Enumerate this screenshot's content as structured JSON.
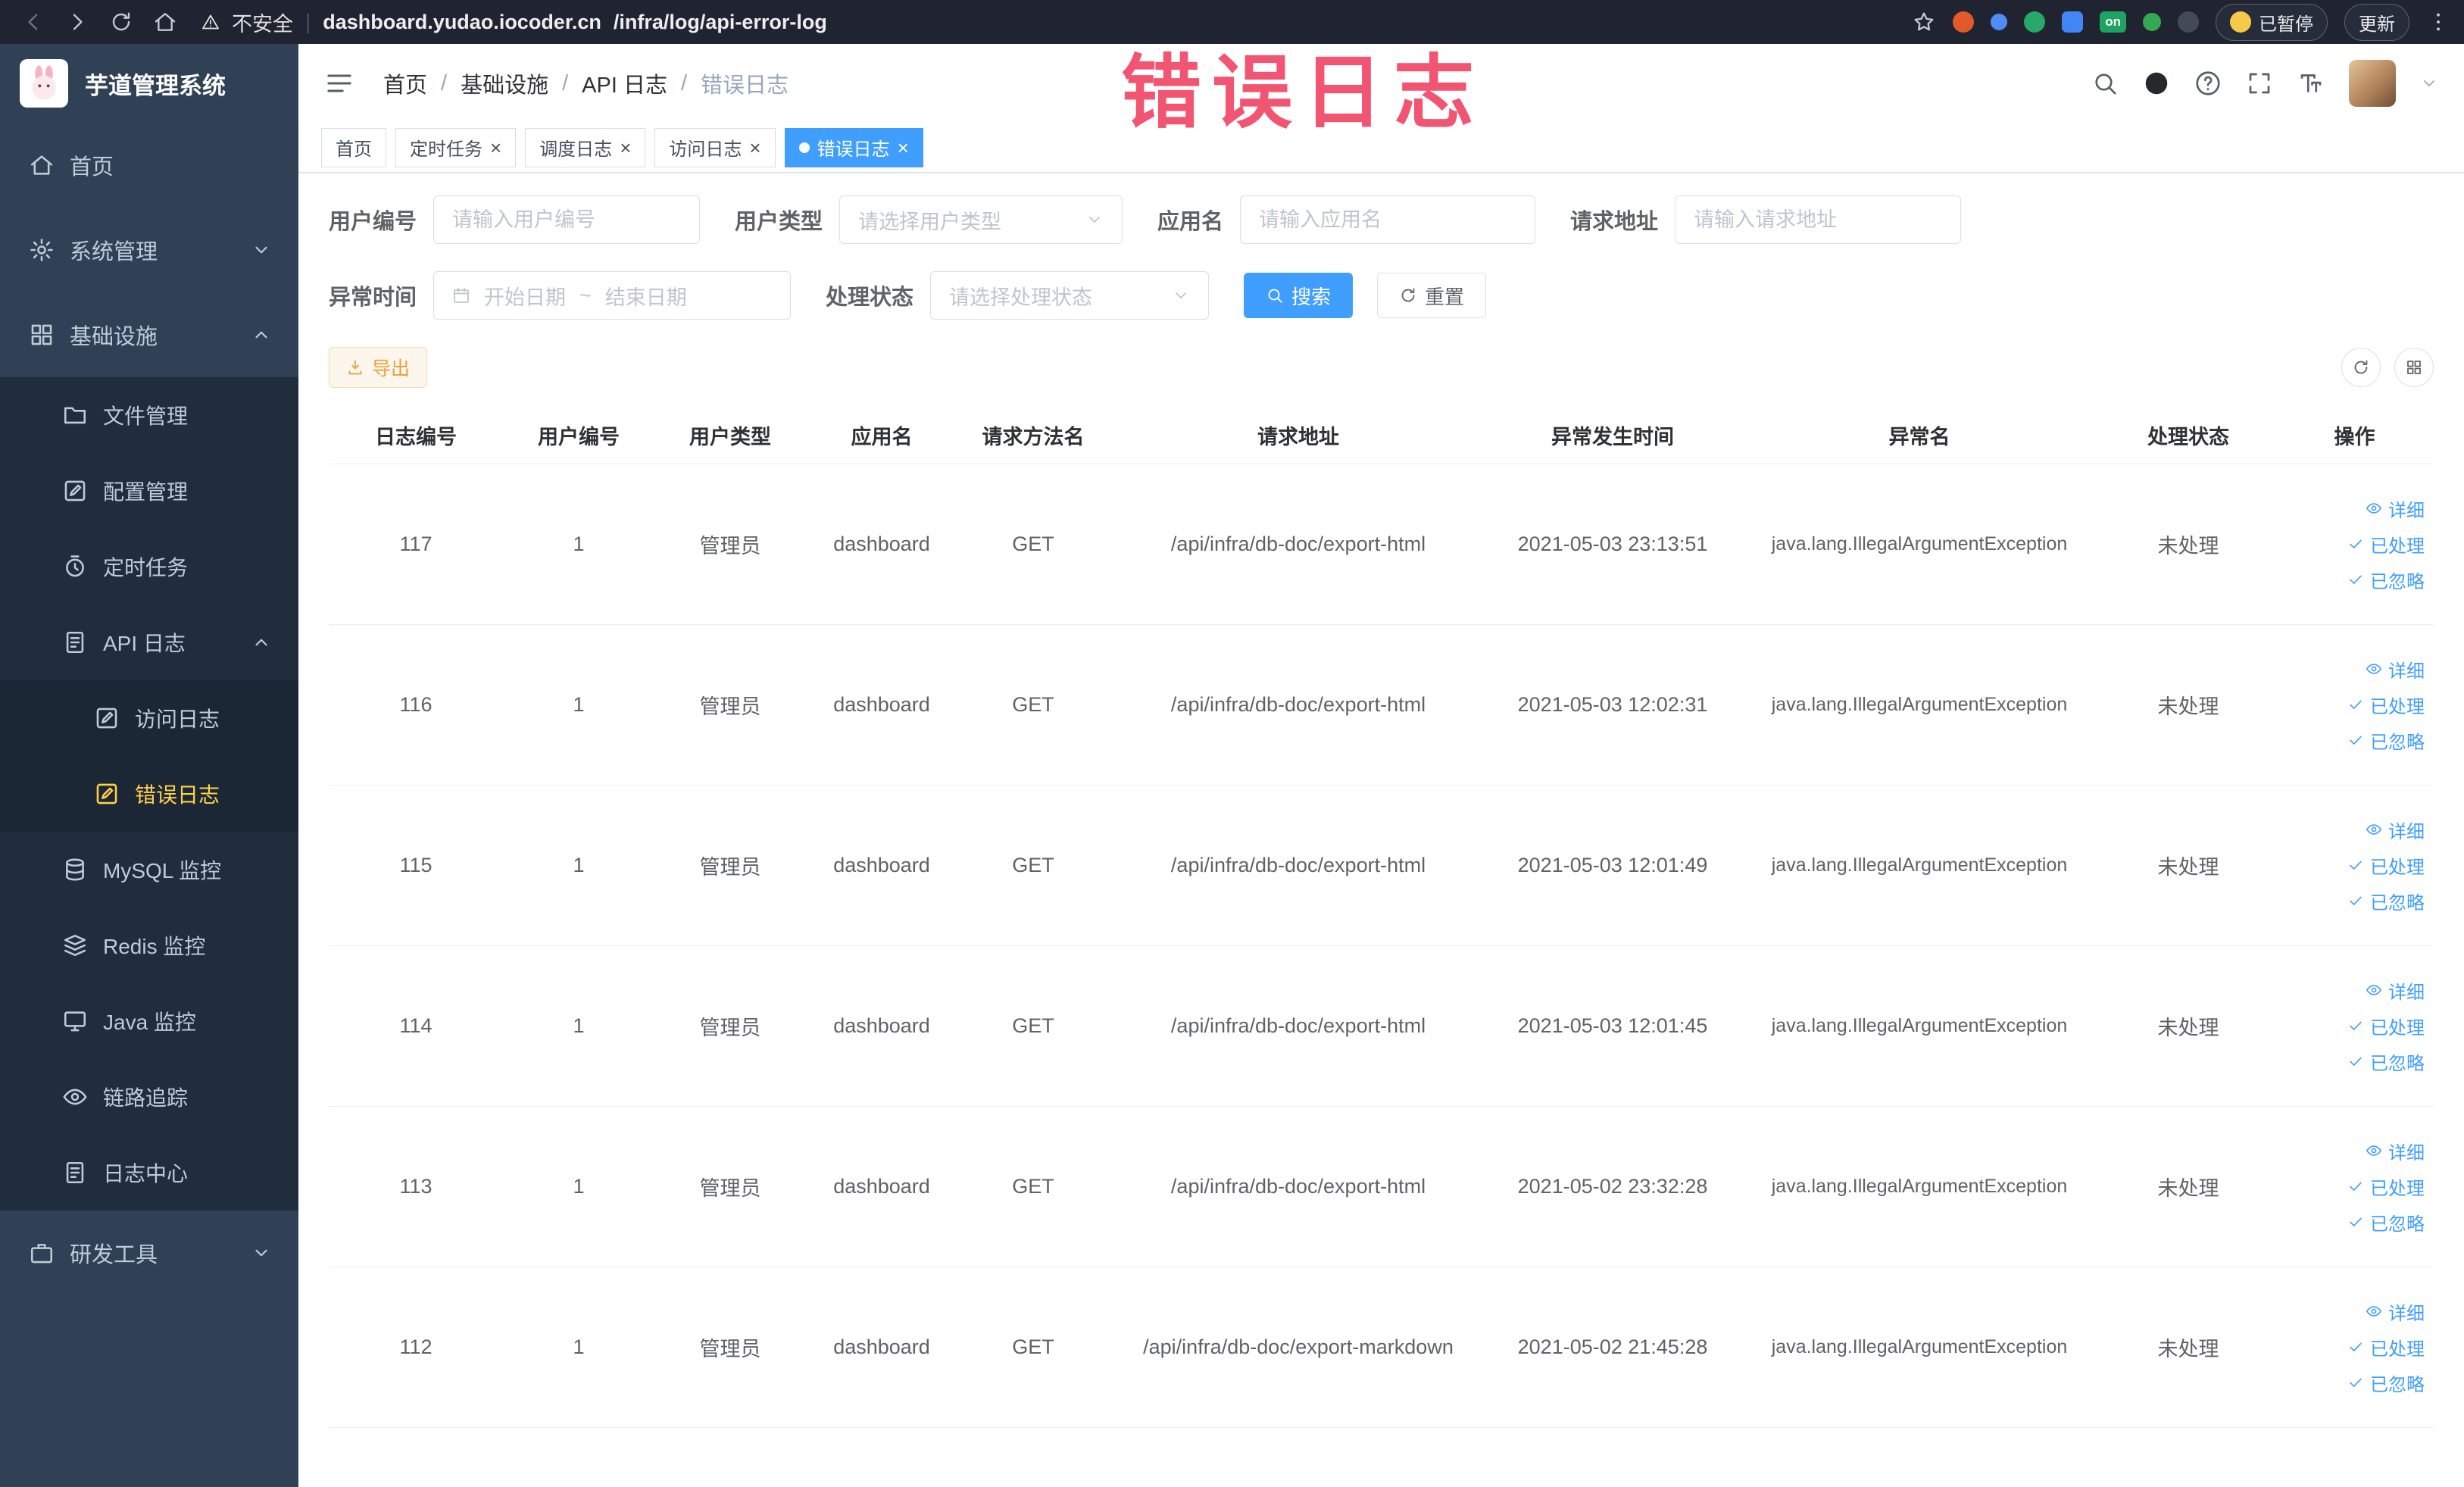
{
  "browser": {
    "security_label": "不安全",
    "url_host": "dashboard.yudao.iocoder.cn",
    "url_path": "/infra/log/api-error-log",
    "paused_label": "已暂停",
    "update_label": "更新",
    "nav_icons": [
      "back-icon",
      "forward-icon",
      "reload-icon",
      "home-icon"
    ],
    "right_icons": [
      "star-icon",
      "extension-icons",
      "menu-dots-icon"
    ]
  },
  "annotation": {
    "text": "错误日志"
  },
  "sidebar": {
    "logo_title": "芋道管理系统",
    "items": [
      {
        "key": "home",
        "label": "首页",
        "icon": "home",
        "level": 1
      },
      {
        "key": "system",
        "label": "系统管理",
        "icon": "gear",
        "level": 1,
        "chevron": "down"
      },
      {
        "key": "infra",
        "label": "基础设施",
        "icon": "grid",
        "level": 1,
        "chevron": "up"
      },
      {
        "key": "file",
        "label": "文件管理",
        "icon": "folder",
        "level": 2
      },
      {
        "key": "config",
        "label": "配置管理",
        "icon": "edit",
        "level": 2
      },
      {
        "key": "job",
        "label": "定时任务",
        "icon": "timer",
        "level": 2
      },
      {
        "key": "api-log",
        "label": "API 日志",
        "icon": "doc",
        "level": 2,
        "chevron": "up"
      },
      {
        "key": "access-log",
        "label": "访问日志",
        "icon": "edit",
        "level": 3
      },
      {
        "key": "error-log",
        "label": "错误日志",
        "icon": "edit",
        "level": 3,
        "active": true
      },
      {
        "key": "mysql",
        "label": "MySQL 监控",
        "icon": "db",
        "level": 2
      },
      {
        "key": "redis",
        "label": "Redis 监控",
        "icon": "layers",
        "level": 2
      },
      {
        "key": "java",
        "label": "Java 监控",
        "icon": "monitor",
        "level": 2
      },
      {
        "key": "trace",
        "label": "链路追踪",
        "icon": "eye",
        "level": 2
      },
      {
        "key": "log-center",
        "label": "日志中心",
        "icon": "doc",
        "level": 2
      },
      {
        "key": "devtools",
        "label": "研发工具",
        "icon": "briefcase",
        "level": 1,
        "chevron": "down"
      }
    ]
  },
  "header": {
    "breadcrumbs": [
      "首页",
      "基础设施",
      "API 日志",
      "错误日志"
    ],
    "right_icons": [
      "search-icon",
      "github-icon",
      "help-icon",
      "fullscreen-icon",
      "font-size-icon",
      "avatar",
      "caret-down-icon"
    ]
  },
  "tabs": [
    {
      "key": "home",
      "label": "首页",
      "closable": false,
      "active": false
    },
    {
      "key": "scheduled-jobs",
      "label": "定时任务",
      "closable": true,
      "active": false
    },
    {
      "key": "schedule-log",
      "label": "调度日志",
      "closable": true,
      "active": false
    },
    {
      "key": "access-log",
      "label": "访问日志",
      "closable": true,
      "active": false
    },
    {
      "key": "error-log",
      "label": "错误日志",
      "closable": true,
      "active": true
    }
  ],
  "filters": {
    "user_id": {
      "label": "用户编号",
      "placeholder": "请输入用户编号"
    },
    "user_type": {
      "label": "用户类型",
      "placeholder": "请选择用户类型"
    },
    "app_name": {
      "label": "应用名",
      "placeholder": "请输入应用名"
    },
    "request_url": {
      "label": "请求地址",
      "placeholder": "请输入请求地址"
    },
    "exception_time": {
      "label": "异常时间",
      "start_placeholder": "开始日期",
      "separator": "~",
      "end_placeholder": "结束日期"
    },
    "process_status": {
      "label": "处理状态",
      "placeholder": "请选择处理状态"
    },
    "search_label": "搜索",
    "reset_label": "重置"
  },
  "toolbar": {
    "export_label": "导出"
  },
  "table": {
    "columns": [
      "日志编号",
      "用户编号",
      "用户类型",
      "应用名",
      "请求方法名",
      "请求地址",
      "异常发生时间",
      "异常名",
      "处理状态",
      "操作"
    ],
    "actions": {
      "detail": "详细",
      "processed": "已处理",
      "ignored": "已忽略"
    },
    "rows": [
      {
        "id": "117",
        "user_id": "1",
        "user_type": "管理员",
        "app": "dashboard",
        "method": "GET",
        "url": "/api/infra/db-doc/export-html",
        "time": "2021-05-03 23:13:51",
        "exception": "java.lang.IllegalArgumentException",
        "status": "未处理"
      },
      {
        "id": "116",
        "user_id": "1",
        "user_type": "管理员",
        "app": "dashboard",
        "method": "GET",
        "url": "/api/infra/db-doc/export-html",
        "time": "2021-05-03 12:02:31",
        "exception": "java.lang.IllegalArgumentException",
        "status": "未处理"
      },
      {
        "id": "115",
        "user_id": "1",
        "user_type": "管理员",
        "app": "dashboard",
        "method": "GET",
        "url": "/api/infra/db-doc/export-html",
        "time": "2021-05-03 12:01:49",
        "exception": "java.lang.IllegalArgumentException",
        "status": "未处理"
      },
      {
        "id": "114",
        "user_id": "1",
        "user_type": "管理员",
        "app": "dashboard",
        "method": "GET",
        "url": "/api/infra/db-doc/export-html",
        "time": "2021-05-03 12:01:45",
        "exception": "java.lang.IllegalArgumentException",
        "status": "未处理"
      },
      {
        "id": "113",
        "user_id": "1",
        "user_type": "管理员",
        "app": "dashboard",
        "method": "GET",
        "url": "/api/infra/db-doc/export-html",
        "time": "2021-05-02 23:32:28",
        "exception": "java.lang.IllegalArgumentException",
        "status": "未处理"
      },
      {
        "id": "112",
        "user_id": "1",
        "user_type": "管理员",
        "app": "dashboard",
        "method": "GET",
        "url": "/api/infra/db-doc/export-markdown",
        "time": "2021-05-02 21:45:28",
        "exception": "java.lang.IllegalArgumentException",
        "status": "未处理"
      }
    ]
  },
  "colors": {
    "primary": "#409eff",
    "sidebar_bg": "#304156",
    "submenu_bg": "#1f2d3d",
    "active_menu_text": "#ffd04b",
    "export_text": "#e6a23c",
    "annotation_red": "#f03e5f"
  }
}
